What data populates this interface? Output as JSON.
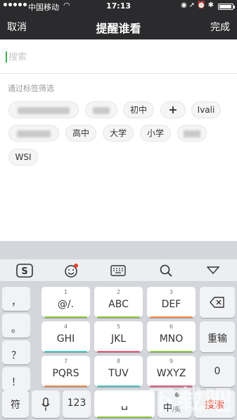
{
  "status": {
    "carrier": "中国移动",
    "time": "17:13"
  },
  "nav": {
    "cancel_label": "取消",
    "title": "提醒谁看",
    "done_label": "完成"
  },
  "search": {
    "placeholder": "搜索"
  },
  "tags": {
    "section_label": "通过标签筛选",
    "row1": [
      "初中",
      "+",
      "Ivali"
    ],
    "row2": [
      "高中",
      "大学",
      "小学"
    ],
    "row3": [
      "WSI"
    ]
  },
  "keyboard": {
    "side_keys": [
      "，",
      "。",
      "？",
      "！"
    ],
    "keys": [
      {
        "num": "1",
        "label": "@/."
      },
      {
        "num": "2",
        "label": "ABC"
      },
      {
        "num": "3",
        "label": "DEF"
      },
      {
        "num": "4",
        "label": "GHI"
      },
      {
        "num": "5",
        "label": "JKL"
      },
      {
        "num": "6",
        "label": "MNO"
      },
      {
        "num": "7",
        "label": "PQRS"
      },
      {
        "num": "8",
        "label": "TUV"
      },
      {
        "num": "9",
        "label": "WXYZ"
      }
    ],
    "reenter_label": "重输",
    "zero_label": "0",
    "symbol_label": "符",
    "num_label": "123",
    "space_label": "␣",
    "lang_top": "中",
    "lang_bottom": "/英",
    "search_label": "搜索",
    "colors": {
      "green": "#8cc63f",
      "orange": "#f08a4b",
      "teal": "#4cc7c0",
      "pink": "#e85b7a",
      "accent": "#e8412c"
    }
  }
}
